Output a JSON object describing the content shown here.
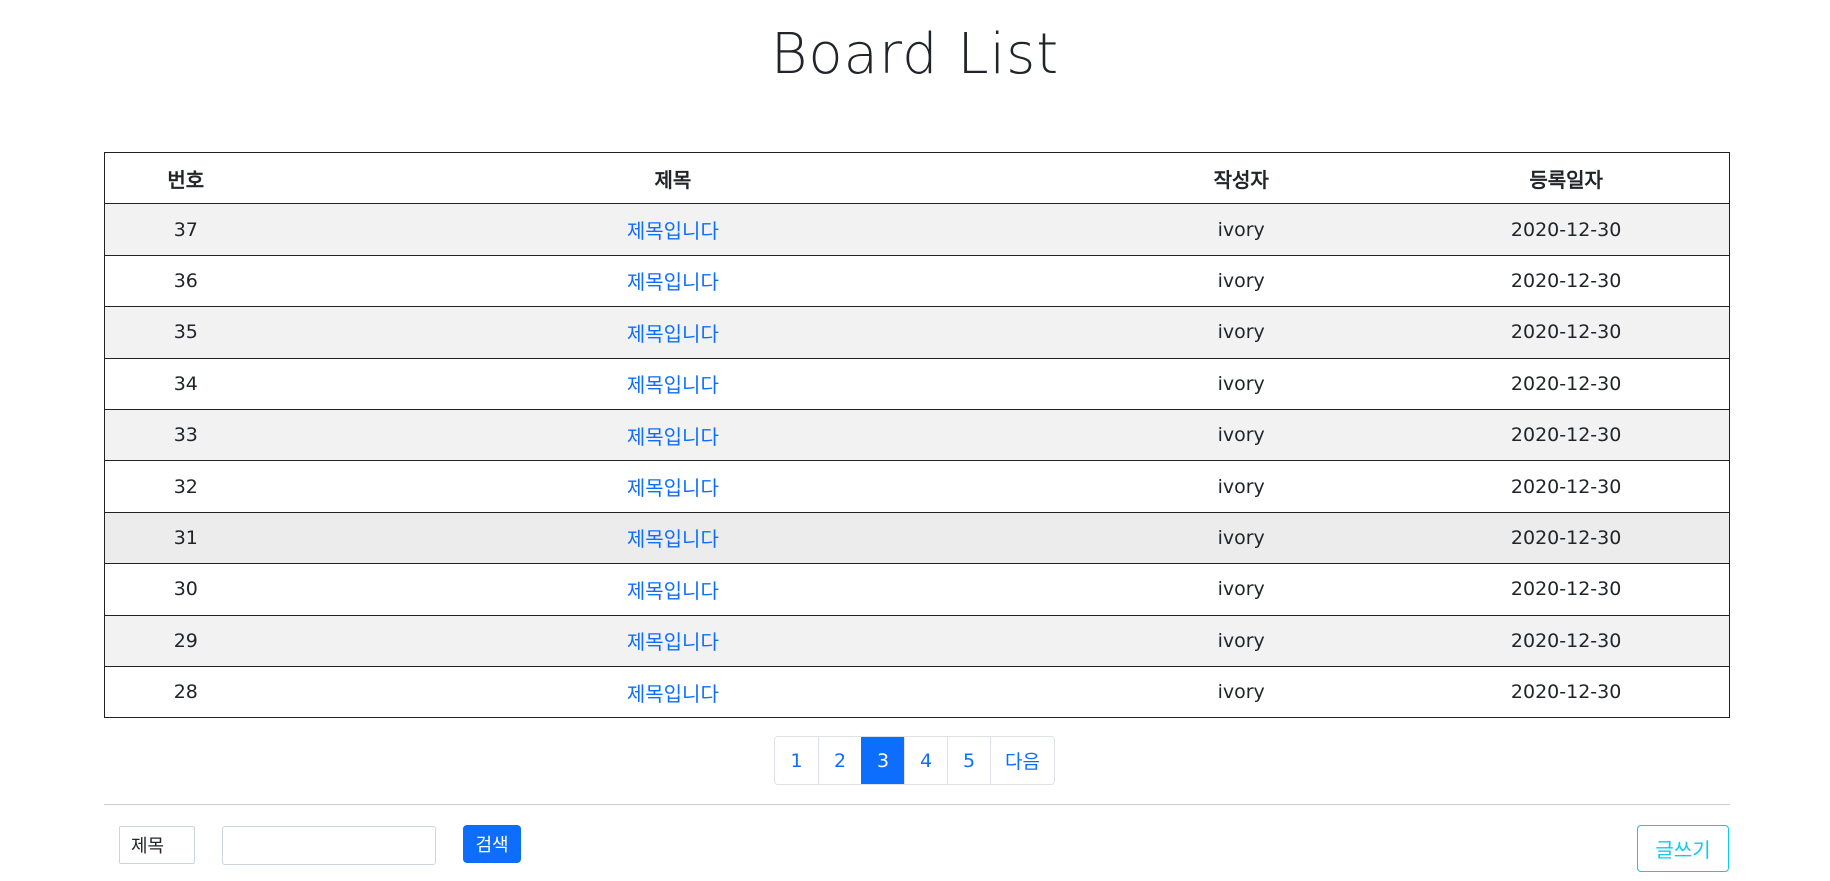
{
  "page_title": "Board List",
  "table": {
    "headers": {
      "no": "번호",
      "title": "제목",
      "writer": "작성자",
      "date": "등록일자"
    },
    "rows": [
      {
        "no": "37",
        "title": "제목입니다",
        "writer": "ivory",
        "date": "2020-12-30"
      },
      {
        "no": "36",
        "title": "제목입니다",
        "writer": "ivory",
        "date": "2020-12-30"
      },
      {
        "no": "35",
        "title": "제목입니다",
        "writer": "ivory",
        "date": "2020-12-30"
      },
      {
        "no": "34",
        "title": "제목입니다",
        "writer": "ivory",
        "date": "2020-12-30"
      },
      {
        "no": "33",
        "title": "제목입니다",
        "writer": "ivory",
        "date": "2020-12-30"
      },
      {
        "no": "32",
        "title": "제목입니다",
        "writer": "ivory",
        "date": "2020-12-30"
      },
      {
        "no": "31",
        "title": "제목입니다",
        "writer": "ivory",
        "date": "2020-12-30"
      },
      {
        "no": "30",
        "title": "제목입니다",
        "writer": "ivory",
        "date": "2020-12-30"
      },
      {
        "no": "29",
        "title": "제목입니다",
        "writer": "ivory",
        "date": "2020-12-30"
      },
      {
        "no": "28",
        "title": "제목입니다",
        "writer": "ivory",
        "date": "2020-12-30"
      }
    ]
  },
  "pagination": {
    "pages": [
      "1",
      "2",
      "3",
      "4",
      "5"
    ],
    "current": "3",
    "next_label": "다음"
  },
  "search": {
    "field_selected": "제목",
    "query_value": "",
    "query_placeholder": "",
    "button_label": "검색"
  },
  "write_button_label": "글쓰기",
  "colors": {
    "primary": "#0d6efd",
    "info": "#0dcaf0",
    "row_stripe": "#f2f2f2"
  }
}
